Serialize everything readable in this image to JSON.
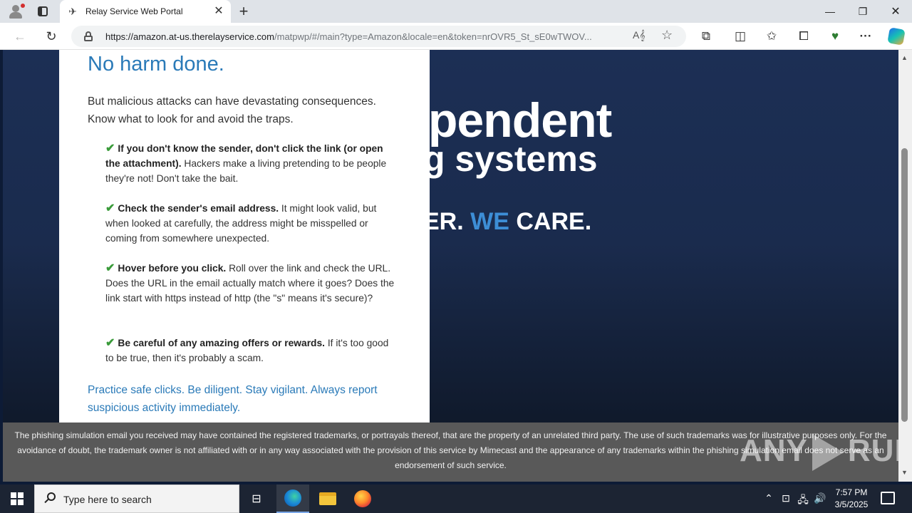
{
  "browser": {
    "tab_title": "Relay Service Web Portal",
    "url_host": "https://amazon.at-us.therelayservice.com",
    "url_rest": "/matpwp/#/main?type=Amazon&locale=en&token=nrOVR5_St_sE0wTWOV...",
    "icons": {
      "back": "back-arrow",
      "refresh": "refresh",
      "lock": "lock",
      "read_aloud": "read-aloud",
      "favorite": "star",
      "extensions": "puzzle",
      "split": "split-screen",
      "favorites": "favorites-star",
      "collections": "collections",
      "performance": "heart-pulse",
      "menu": "more",
      "copilot": "copilot"
    }
  },
  "hero": {
    "line1": "ependent",
    "line2": "g systems",
    "line3_a": "ER.",
    "line3_we": "WE",
    "line3_b": "CARE."
  },
  "card": {
    "title": "No harm done.",
    "intro": "But malicious attacks can have devastating consequences. Know what to look for and avoid the traps.",
    "tips": [
      {
        "bold": "If you don't know the sender, don't click the link (or open the attachment).",
        "text": " Hackers make a living pretending to be people they're not! Don't take the bait."
      },
      {
        "bold": "Check the sender's email address.",
        "text": " It might look valid, but when looked at carefully, the address might be misspelled or coming from somewhere unexpected."
      },
      {
        "bold": "Hover before you click.",
        "text": " Roll over the link and check the URL. Does the URL in the email actually match where it goes? Does the link start with https instead of http (the \"s\" means it's secure)?"
      },
      {
        "bold": "Be careful of any amazing offers or rewards.",
        "text": " If it's too good to be true, then it's probably a scam."
      }
    ],
    "footer": "Practice safe clicks. Be diligent. Stay vigilant. Always report suspicious activity immediately."
  },
  "disclaimer": "The phishing simulation email you received may have contained the registered trademarks, or portrayals thereof, that are the property of an unrelated third party. The use of such trademarks was for illustrative purposes only. For the avoidance of doubt, the trademark owner is not affiliated with or in any way associated with the provision of this service by Mimecast and the appearance of any trademarks within the phishing simulation email does not serve as an endorsement of such service.",
  "watermark": {
    "left": "ANY",
    "right": "RUN"
  },
  "taskbar": {
    "search_placeholder": "Type here to search",
    "time": "7:57 PM",
    "date": "3/5/2025"
  },
  "colors": {
    "accent_blue": "#2a7ab8",
    "we_blue": "#3d8ed6",
    "check_green": "#3a9b3a",
    "hero_bg": "#1c2f55"
  }
}
